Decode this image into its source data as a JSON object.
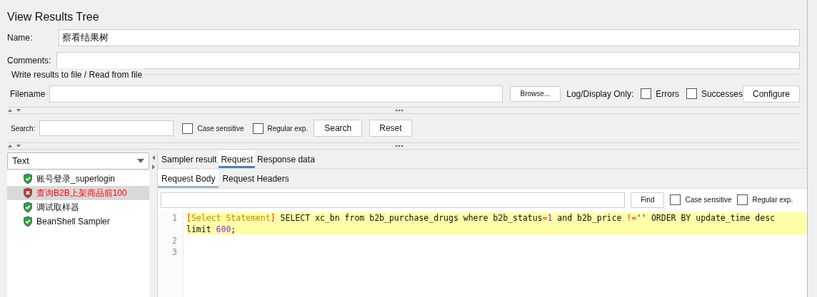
{
  "title": "View Results Tree",
  "name": {
    "label": "Name:",
    "value": "察看结果树"
  },
  "comments": {
    "label": "Comments:"
  },
  "file_section": {
    "legend": "Write results to file / Read from file",
    "filename_label": "Filename",
    "browse_button": "Browse...",
    "log_label": "Log/Display Only:",
    "checkboxes": [
      {
        "label": "Errors",
        "checked": false
      },
      {
        "label": "Successes",
        "checked": false
      }
    ],
    "configure_button": "Configure"
  },
  "search": {
    "label": "Search:",
    "checkboxes": [
      {
        "label": "Case sensitive",
        "checked": false
      },
      {
        "label": "Regular exp.",
        "checked": false
      }
    ],
    "search_button": "Search",
    "reset_button": "Reset"
  },
  "renderer": {
    "value": "Text"
  },
  "tree": [
    {
      "label": "账号登录_superlogin",
      "failed": false,
      "selected": false
    },
    {
      "label": "查询B2B上架商品前100",
      "failed": true,
      "selected": true
    },
    {
      "label": "调试取样器",
      "failed": false,
      "selected": false
    },
    {
      "label": "BeanShell Sampler",
      "failed": false,
      "selected": false
    }
  ],
  "tabs": [
    {
      "label": "Sampler result",
      "selected": false
    },
    {
      "label": "Request",
      "selected": true
    },
    {
      "label": "Response data",
      "selected": false
    }
  ],
  "subtabs": [
    {
      "label": "Request Body",
      "selected": true
    },
    {
      "label": "Request Headers",
      "selected": false
    }
  ],
  "find": {
    "button": "Find",
    "checkboxes": [
      {
        "label": "Case sensitive",
        "checked": false
      },
      {
        "label": "Regular exp.",
        "checked": false
      }
    ]
  },
  "code": {
    "lines": [
      {
        "number": "1",
        "highlighted": true,
        "tokens": [
          {
            "text": "[",
            "kind": "bracket"
          },
          {
            "text": "Select Statement",
            "kind": "label"
          },
          {
            "text": "]",
            "kind": "bracket"
          },
          {
            "text": " SELECT xc_bn from b2b_purchase_drugs where b2b_status",
            "kind": "plain"
          },
          {
            "text": "=",
            "kind": "operator"
          },
          {
            "text": "1",
            "kind": "number"
          },
          {
            "text": " and b2b_price ",
            "kind": "plain"
          },
          {
            "text": "!=",
            "kind": "operator"
          },
          {
            "text": "'' ORDER BY update_time desc limit ",
            "kind": "plain"
          },
          {
            "text": "600",
            "kind": "number"
          },
          {
            "text": ";",
            "kind": "plain"
          }
        ]
      },
      {
        "number": "2",
        "highlighted": false
      },
      {
        "number": "3",
        "highlighted": false
      }
    ]
  }
}
